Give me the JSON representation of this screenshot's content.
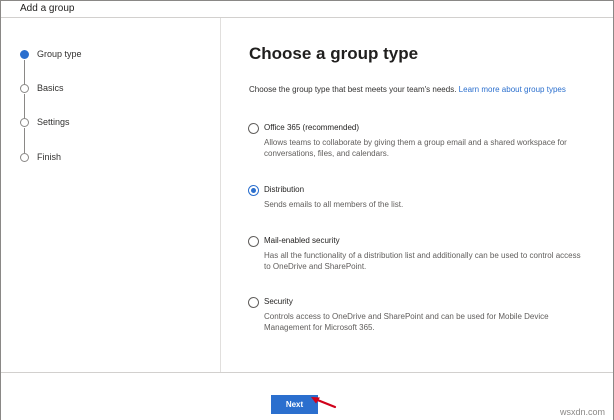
{
  "window": {
    "title": "Add a group"
  },
  "steps": [
    {
      "label": "Group type",
      "active": true
    },
    {
      "label": "Basics",
      "active": false
    },
    {
      "label": "Settings",
      "active": false
    },
    {
      "label": "Finish",
      "active": false
    }
  ],
  "main": {
    "title": "Choose a group type",
    "intro": "Choose the group type that best meets your team's needs.",
    "learn_more": "Learn more about group types",
    "options": [
      {
        "label": "Office 365 (recommended)",
        "description": "Allows teams to collaborate by giving them a group email and a shared workspace for conversations, files, and calendars.",
        "selected": false
      },
      {
        "label": "Distribution",
        "description": "Sends emails to all members of the list.",
        "selected": true
      },
      {
        "label": "Mail-enabled security",
        "description": "Has all the functionality of a distribution list and additionally can be used to control access to OneDrive and SharePoint.",
        "selected": false
      },
      {
        "label": "Security",
        "description": "Controls access to OneDrive and SharePoint and can be used for Mobile Device Management for Microsoft 365.",
        "selected": false
      }
    ]
  },
  "footer": {
    "next_label": "Next"
  },
  "watermark": "wsxdn.com",
  "colors": {
    "accent": "#2b6fce",
    "annotation": "#d0021b"
  }
}
